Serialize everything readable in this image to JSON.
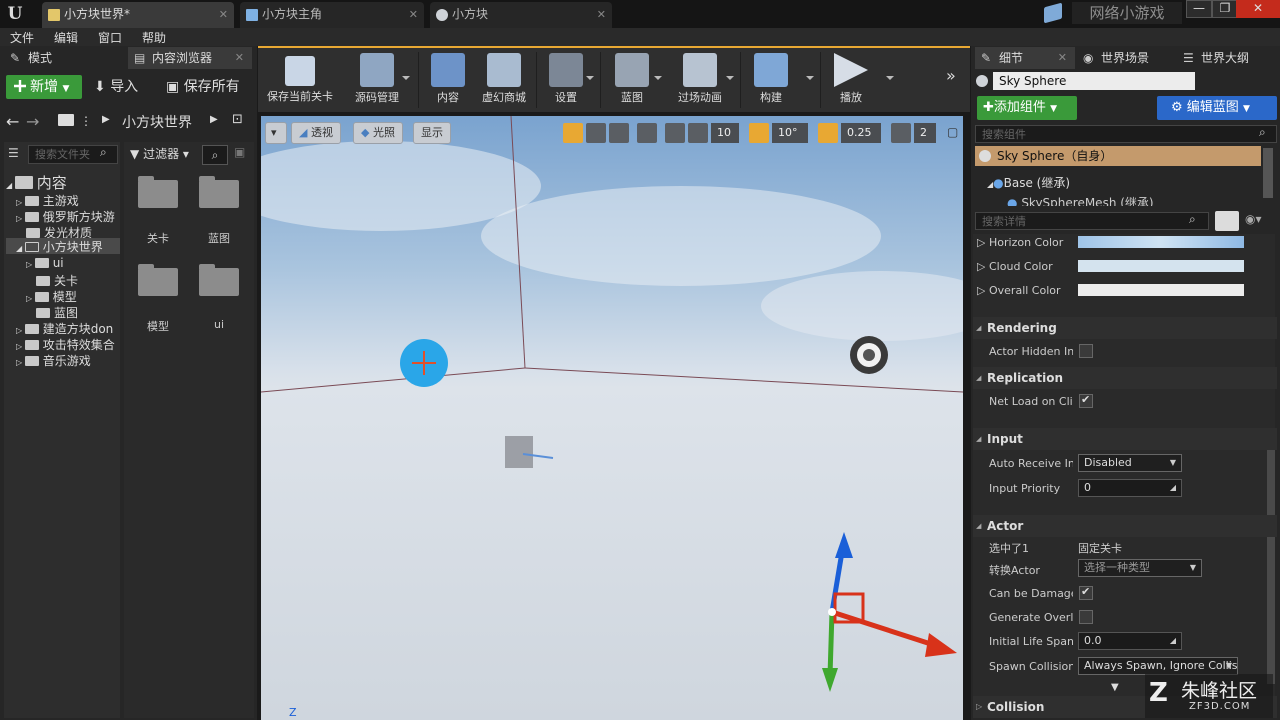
{
  "titlebar": {
    "tabs": [
      {
        "label": "小方块世界*"
      },
      {
        "label": "小方块主角"
      },
      {
        "label": "小方块"
      }
    ],
    "brand": "网络小游戏",
    "window_buttons": {
      "minimize": "—",
      "maximize": "❐",
      "close": "✕"
    }
  },
  "menubar": {
    "items": [
      "文件",
      "编辑",
      "窗口",
      "帮助"
    ]
  },
  "left_panel": {
    "tabs": [
      "模式",
      "内容浏览器"
    ],
    "add_new": "新增",
    "import": "导入",
    "save_all": "保存所有",
    "breadcrumb": {
      "root": "⋮",
      "current": "小方块世界"
    },
    "folder_search_placeholder": "搜索文件夹",
    "filter_label": "过滤器",
    "tree": {
      "root": "内容",
      "items": [
        "主游戏",
        "俄罗斯方块游",
        "发光材质",
        "小方块世界",
        "ui",
        "关卡",
        "模型",
        "蓝图",
        "建造方块don",
        "攻击特效集合",
        "音乐游戏"
      ]
    },
    "assets": [
      "关卡",
      "蓝图",
      "模型",
      "ui"
    ]
  },
  "toolbar": {
    "buttons": [
      "保存当前关卡",
      "源码管理",
      "内容",
      "虚幻商城",
      "设置",
      "蓝图",
      "过场动画",
      "构建",
      "播放"
    ],
    "overflow": "»"
  },
  "viewport": {
    "perspective": "透视",
    "lighting": "光照",
    "show": "显示",
    "grid_snap": "10",
    "rotation_snap": "10°",
    "scale_snap": "0.25",
    "camera_speed": "2",
    "axis_label": "Z"
  },
  "right_panel": {
    "tabs": [
      "细节",
      "世界场景",
      "世界大纲"
    ],
    "actor_name": "Sky Sphere",
    "add_component": "添加组件",
    "edit_blueprint": "编辑蓝图",
    "component_search_placeholder": "搜索组件",
    "components": [
      "Sky Sphere（自身）",
      "Base (继承)",
      "SkySphereMesh (继承)"
    ],
    "details_search_placeholder": "搜索详情",
    "colors": [
      {
        "label": "Horizon Color"
      },
      {
        "label": "Cloud Color"
      },
      {
        "label": "Overall Color"
      }
    ],
    "categories": {
      "rendering": "Rendering",
      "replication": "Replication",
      "input": "Input",
      "actor": "Actor",
      "collision": "Collision"
    },
    "actor_hidden": "Actor Hidden In G",
    "net_load": "Net Load on Clier",
    "auto_receive": {
      "label": "Auto Receive Inp",
      "value": "Disabled"
    },
    "input_priority": {
      "label": "Input Priority",
      "value": "0"
    },
    "selected": {
      "label": "选中了1",
      "value": "固定关卡"
    },
    "convert_actor": {
      "label": "转换Actor",
      "value": "选择一种类型"
    },
    "can_be_damaged": "Can be Damaged",
    "generate_overlap": "Generate Overlap",
    "initial_life_span": {
      "label": "Initial Life Span",
      "value": "0.0"
    },
    "spawn_collision": {
      "label": "Spawn Collision H",
      "value": "Always Spawn, Ignore Collis"
    },
    "expand_arrow": "▼"
  },
  "watermark": {
    "name": "朱峰社区",
    "url": "ZF3D.COM"
  }
}
